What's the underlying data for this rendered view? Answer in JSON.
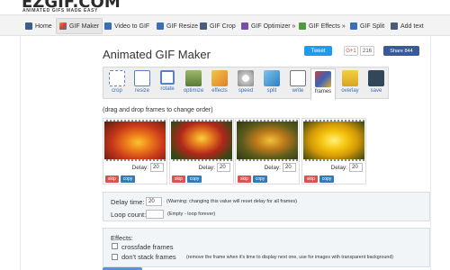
{
  "logo": {
    "text": "EZGIF.COM",
    "tagline": "ANIMATED GIFS MADE EASY"
  },
  "nav": {
    "items": [
      {
        "label": "Home",
        "icon": "home-icon"
      },
      {
        "label": "GIF Maker",
        "icon": "gif-maker-icon",
        "active": true
      },
      {
        "label": "Video to GIF",
        "icon": "video-icon"
      },
      {
        "label": "GIF Resize",
        "icon": "resize-icon"
      },
      {
        "label": "GIF Crop",
        "icon": "crop-icon"
      },
      {
        "label": "GIF Optimizer »",
        "icon": "optimizer-icon"
      },
      {
        "label": "GIF Effects »",
        "icon": "effects-icon"
      },
      {
        "label": "GIF Split",
        "icon": "split-icon"
      },
      {
        "label": "Add text",
        "icon": "text-icon"
      }
    ]
  },
  "page": {
    "title": "Animated GIF Maker"
  },
  "social": {
    "tweet": "Tweet",
    "gplus": "G+1",
    "gplus_count": "216",
    "fb": "Share 844"
  },
  "toolbar": {
    "tools": [
      {
        "label": "crop"
      },
      {
        "label": "resize"
      },
      {
        "label": "rotate"
      },
      {
        "label": "optimize"
      },
      {
        "label": "effects"
      },
      {
        "label": "speed"
      },
      {
        "label": "split"
      },
      {
        "label": "write"
      },
      {
        "label": "frames",
        "active": true
      },
      {
        "label": "overlay"
      },
      {
        "label": "save"
      }
    ]
  },
  "instruction": "(drag and drop frames to change order)",
  "frames": [
    {
      "delay_label": "Delay:",
      "delay": "20",
      "skip": "skip",
      "copy": "copy"
    },
    {
      "delay_label": "Delay:",
      "delay": "20",
      "skip": "skip",
      "copy": "copy"
    },
    {
      "delay_label": "Delay:",
      "delay": "20",
      "skip": "skip",
      "copy": "copy"
    },
    {
      "delay_label": "Delay:",
      "delay": "20",
      "skip": "skip",
      "copy": "copy"
    }
  ],
  "settings": {
    "delay_label": "Delay time:",
    "delay_value": "20",
    "delay_note": "(Warning: changing this value will reset delay for all frames)",
    "loop_label": "Loop count:",
    "loop_value": "",
    "loop_note": "(Empty - loop forever)"
  },
  "effects": {
    "title": "Effects:",
    "crossfade": "crossfade frames",
    "dont_stack": "don't stack frames",
    "dont_stack_note": "(remove the frame when it's time to display next one, use for images with transparent background)"
  }
}
